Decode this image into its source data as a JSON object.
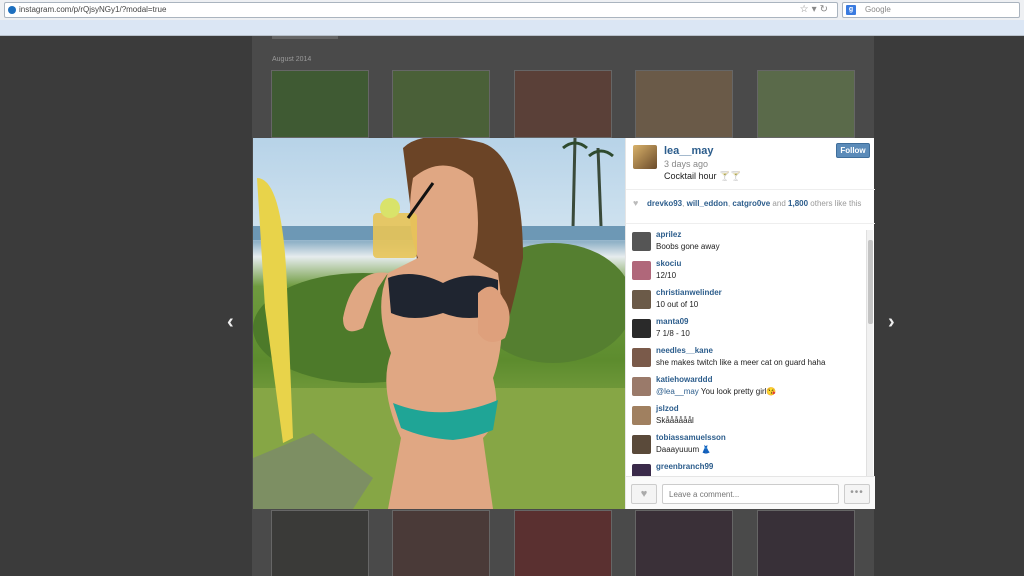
{
  "browser": {
    "url": "instagram.com/p/rQjsyNGy1/?modal=true",
    "search_placeholder": "Google",
    "search_engine_icon": "google-icon"
  },
  "background": {
    "month_label": "August 2014"
  },
  "post": {
    "username": "lea__may",
    "time_ago": "3 days ago",
    "caption": "Cocktail hour 🍸🍸",
    "follow_label": "Follow",
    "likes": {
      "user1": "drevko93",
      "user2": "will_eddon",
      "user3": "catgro0ve",
      "connector": "and",
      "count": "1,800",
      "suffix": "others like this"
    },
    "comments": [
      {
        "user": "aprilez",
        "text": "Boobs gone away",
        "avatar_color": "#555555"
      },
      {
        "user": "skociu",
        "text": "12/10",
        "avatar_color": "#b0677a"
      },
      {
        "user": "christianwelinder",
        "text": "10 out of 10",
        "avatar_color": "#6b5a48"
      },
      {
        "user": "manta09",
        "text": "7 1/8 - 10",
        "avatar_color": "#2a2a2a"
      },
      {
        "user": "needles__kane",
        "text": "she makes twitch like a meer cat on guard haha",
        "avatar_color": "#7a5a4a"
      },
      {
        "user": "katiehowarddd",
        "mention": "@lea__may",
        "text": "You look pretty girl😘",
        "avatar_color": "#9a7a6a"
      },
      {
        "user": "jslzod",
        "text": "Skåååååål",
        "avatar_color": "#a08060"
      },
      {
        "user": "tobiassamuelsson",
        "text": "Daaayuuum 👗",
        "avatar_color": "#5a4a3a"
      },
      {
        "user": "greenbranch99",
        "text": "",
        "avatar_color": "#3a2a4a"
      }
    ],
    "comment_placeholder": "Leave a comment...",
    "more_label": "•••"
  }
}
